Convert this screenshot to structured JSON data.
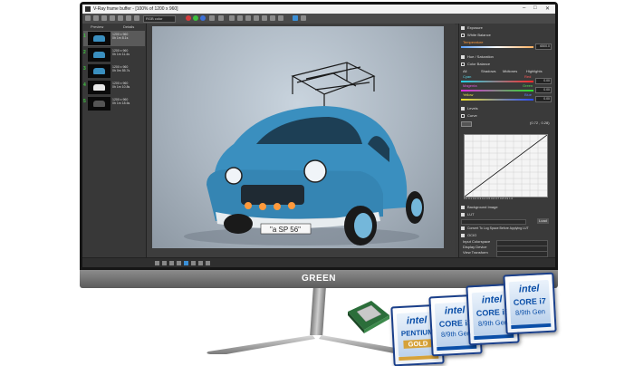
{
  "brand": {
    "monitor": "GREEN"
  },
  "app": {
    "title": "V-Ray frame buffer - [100% of 1200 x 960]",
    "channel": "RGB color",
    "controls": {
      "minimize": "–",
      "maximize": "□",
      "close": "✕"
    }
  },
  "history": {
    "header": {
      "col1": "Preview",
      "col2": "Details"
    },
    "items": [
      {
        "num": "1",
        "details": "1200 x 960\n0h 1m 8.1s"
      },
      {
        "num": "2",
        "details": "1200 x 960\n0h 1m 11.4s"
      },
      {
        "num": "3",
        "details": "1200 x 960\n0h 0m 55.7s"
      },
      {
        "num": "4",
        "details": "1200 x 960\n0h 1m 10.8s"
      },
      {
        "num": "5",
        "details": "1200 x 960\n0h 1m 18.6s"
      }
    ]
  },
  "render": {
    "plate": "\"a SP 56\""
  },
  "panel": {
    "exposure": "Exposure",
    "white_balance": "White Balance",
    "temperature": "Temperature",
    "temperature_value": "6500.0",
    "hue_saturation": "Hue / Saturation",
    "color_balance": "Color Balance",
    "tones": {
      "all": "All",
      "shadows": "Shadows",
      "midtones": "Midtones",
      "highlights": "Highlights"
    },
    "cyan": "Cyan",
    "red": "Red",
    "magenta": "Magenta",
    "green": "Green",
    "yellow": "Yellow",
    "blue": "Blue",
    "levels": "Levels",
    "curve": "Curve",
    "curve_readout": "(0.72 , 0.28)",
    "curve_axis": "0.0  0.1  0.2  0.3  0.4  0.5  0.6  0.7  0.8  0.9  1.0",
    "background_image": "Background Image",
    "lut": "LUT",
    "lut_button": "Load",
    "lut_log": "Convert To Log Space Before Applying LUT",
    "ocio": "OCIO",
    "input_colorspace": "Input Colorspace",
    "display_device": "Display Device",
    "view_transform": "View Transform",
    "icc": "ICC",
    "zero": "0.00"
  },
  "cpus": [
    {
      "tier": "PENTIUM",
      "gen": "GOLD"
    },
    {
      "tier": "CORE i3",
      "gen": "8/9th Gen"
    },
    {
      "tier": "CORE i5",
      "gen": "8/9th Gen"
    },
    {
      "tier": "CORE i7",
      "gen": "8/9th Gen"
    }
  ],
  "intel": "intel",
  "colors": {
    "bezel": "#151515",
    "app_bg": "#3c3c3c",
    "car": "#3a8fbf",
    "intel_blue": "#0b4fa8",
    "history_number": "#3ec43e"
  }
}
